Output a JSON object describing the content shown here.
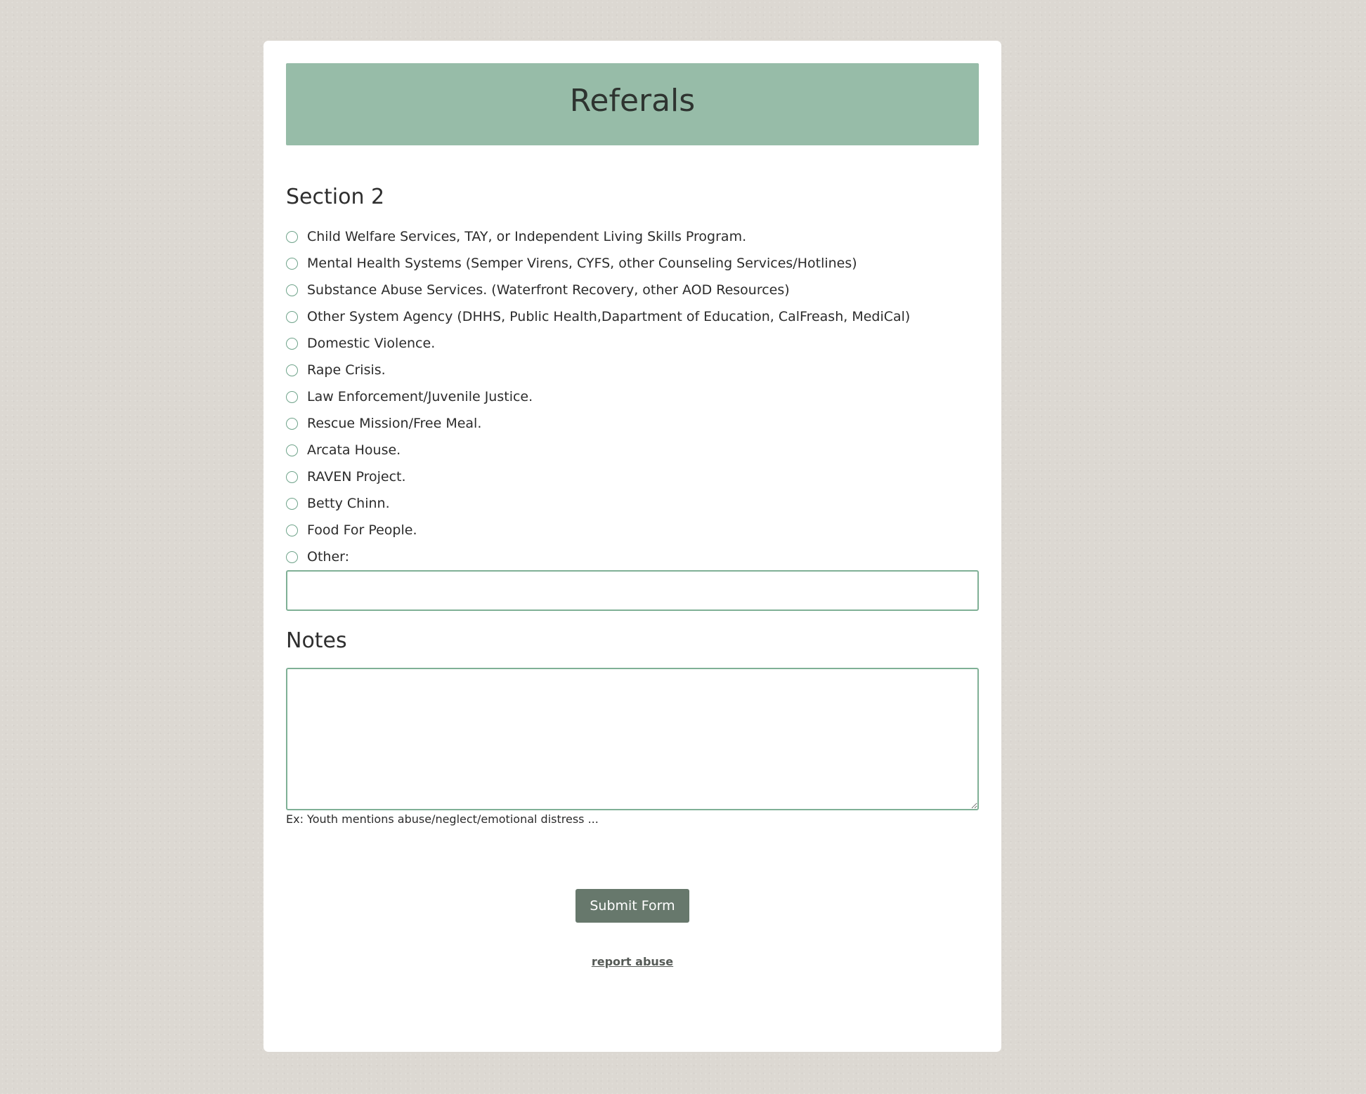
{
  "form": {
    "title": "Referals",
    "section_title": "Section 2",
    "options": [
      {
        "label": "Child Welfare Services, TAY, or Independent Living Skills Program."
      },
      {
        "label": "Mental Health Systems (Semper Virens, CYFS, other Counseling Services/Hotlines)"
      },
      {
        "label": "Substance Abuse Services. (Waterfront Recovery, other AOD Resources)"
      },
      {
        "label": "Other System Agency (DHHS, Public Health,Dapartment of Education, CalFreash, MediCal)"
      },
      {
        "label": "Domestic Violence."
      },
      {
        "label": "Rape Crisis."
      },
      {
        "label": "Law Enforcement/Juvenile Justice."
      },
      {
        "label": "Rescue Mission/Free Meal."
      },
      {
        "label": "Arcata House."
      },
      {
        "label": "RAVEN Project."
      },
      {
        "label": "Betty Chinn."
      },
      {
        "label": "Food For People."
      },
      {
        "label": "Other:"
      }
    ],
    "other_input": {
      "value": "",
      "placeholder": ""
    },
    "notes_title": "Notes",
    "notes_area": {
      "value": "",
      "placeholder": ""
    },
    "notes_hint": "Ex: Youth mentions abuse/neglect/emotional distress ...",
    "submit_label": "Submit Form",
    "report_link": "report abuse"
  },
  "colors": {
    "page_background": "#dcd8d2",
    "card_background": "#ffffff",
    "header_background": "#97bca8",
    "accent_border": "#7fb096",
    "radio_border": "#6fa38a",
    "submit_background": "#67786c",
    "submit_text": "#ffffff",
    "text": "#2b2b2b"
  },
  "icons": {
    "radio": "radio-unchecked-icon"
  }
}
